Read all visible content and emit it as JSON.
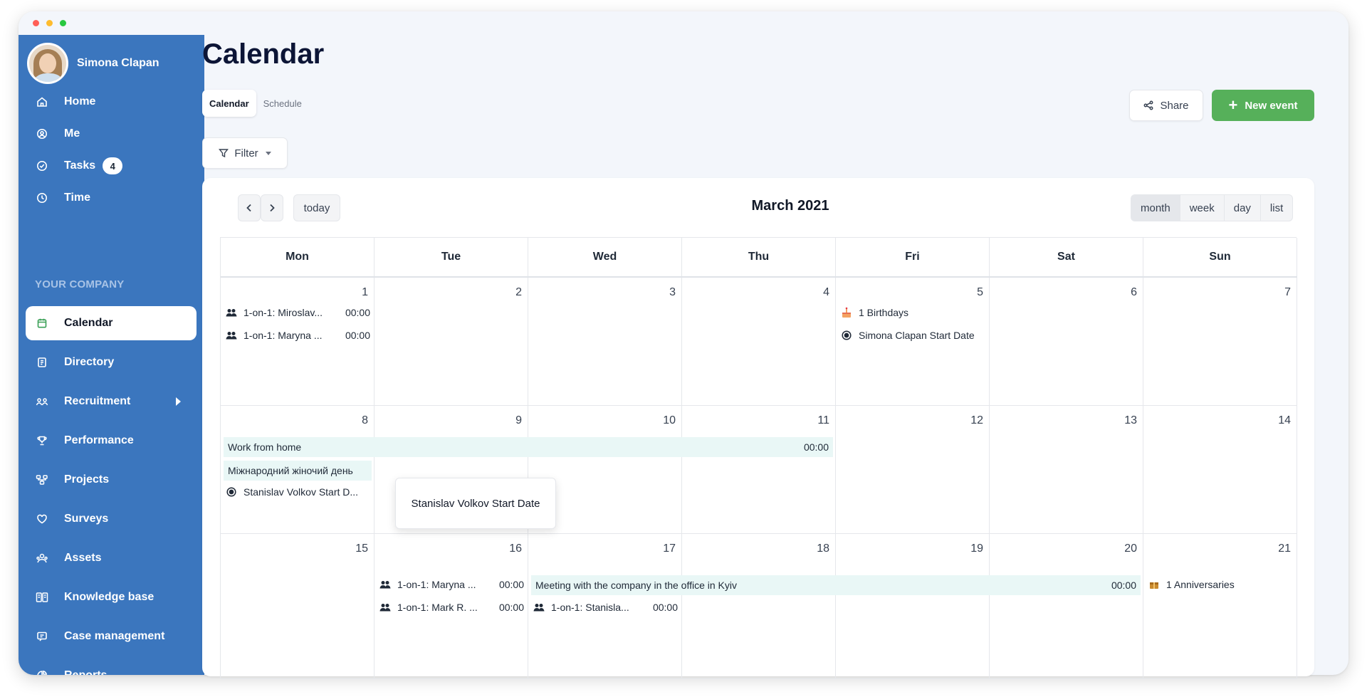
{
  "user": {
    "name": "Simona Clapan"
  },
  "sidebar": {
    "items": [
      {
        "label": "Home",
        "icon": "home-icon"
      },
      {
        "label": "Me",
        "icon": "user-circle-icon"
      },
      {
        "label": "Tasks",
        "icon": "check-circle-icon",
        "badge": "4"
      },
      {
        "label": "Time",
        "icon": "clock-icon"
      }
    ],
    "section_label": "YOUR COMPANY",
    "company_items": [
      {
        "label": "Calendar",
        "icon": "calendar-icon",
        "active": true
      },
      {
        "label": "Directory",
        "icon": "directory-icon"
      },
      {
        "label": "Recruitment",
        "icon": "recruitment-icon"
      },
      {
        "label": "Performance",
        "icon": "trophy-icon"
      },
      {
        "label": "Projects",
        "icon": "projects-icon"
      },
      {
        "label": "Surveys",
        "icon": "heart-icon"
      },
      {
        "label": "Assets",
        "icon": "assets-icon"
      },
      {
        "label": "Knowledge base",
        "icon": "book-icon"
      },
      {
        "label": "Case management",
        "icon": "chat-icon"
      },
      {
        "label": "Reports",
        "icon": "pie-chart-icon"
      }
    ]
  },
  "page": {
    "title": "Calendar",
    "tabs": [
      "Calendar",
      "Schedule"
    ],
    "share_label": "Share",
    "new_event_label": "New event",
    "filter_label": "Filter"
  },
  "calendar": {
    "title": "March 2021",
    "today_label": "today",
    "views": [
      "month",
      "week",
      "day",
      "list"
    ],
    "weekdays": [
      "Mon",
      "Tue",
      "Wed",
      "Thu",
      "Fri",
      "Sat",
      "Sun"
    ],
    "weeks": [
      [
        "1",
        "2",
        "3",
        "4",
        "5",
        "6",
        "7"
      ],
      [
        "8",
        "9",
        "10",
        "11",
        "12",
        "13",
        "14"
      ],
      [
        "15",
        "16",
        "17",
        "18",
        "19",
        "20",
        "21"
      ]
    ],
    "events": {
      "w1_mon_1": {
        "title": "1-on-1: Miroslav...",
        "time": "00:00"
      },
      "w1_mon_2": {
        "title": "1-on-1: Maryna ...",
        "time": "00:00"
      },
      "w1_fri_1": {
        "title": "1 Birthdays"
      },
      "w1_fri_2": {
        "title": "Simona Clapan Start Date"
      },
      "w2_band_1": {
        "title": "Work from home",
        "time": "00:00"
      },
      "w2_band_2": {
        "title": "Міжнародний жіночий день"
      },
      "w2_mon_3": {
        "title": "Stanislav Volkov Start D..."
      },
      "w3_tue_1": {
        "title": "1-on-1: Maryna ...",
        "time": "00:00"
      },
      "w3_tue_2": {
        "title": "1-on-1: Mark R. ...",
        "time": "00:00"
      },
      "w3_band_1": {
        "title": "Meeting with the company in the office in Kyiv",
        "time": "00:00"
      },
      "w3_wed_1": {
        "title": "1-on-1: Stanisla...",
        "time": "00:00"
      },
      "w3_sun_1": {
        "title": "1 Anniversaries"
      }
    },
    "popover": {
      "title": "Stanislav Volkov Start Date"
    }
  }
}
